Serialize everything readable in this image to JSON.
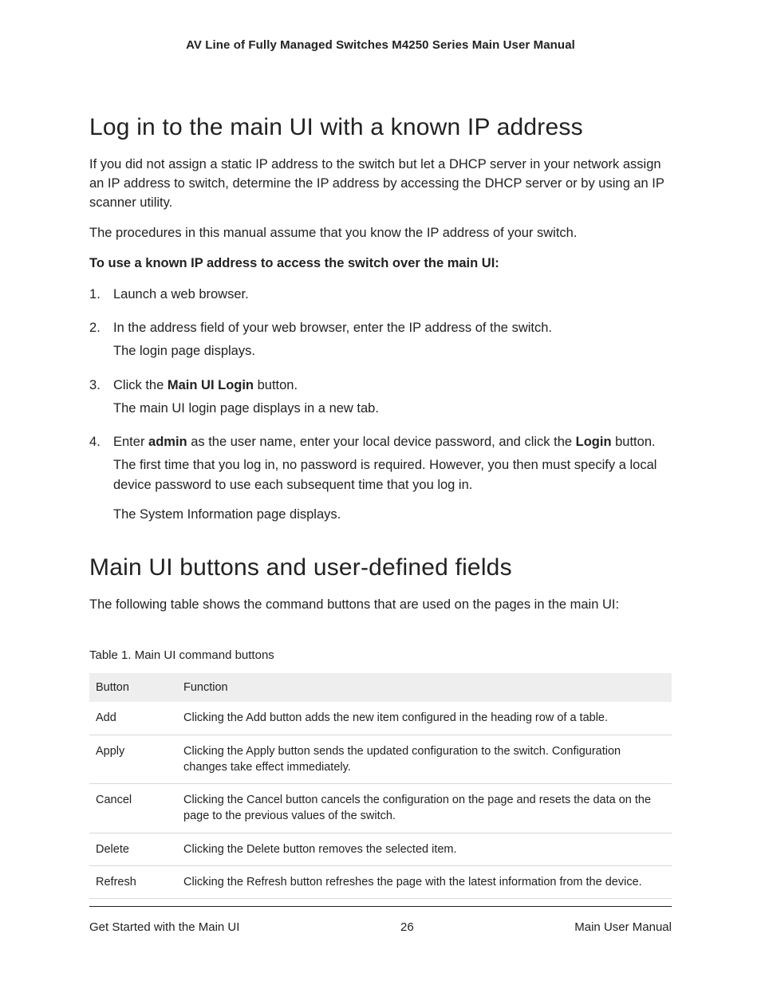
{
  "header": {
    "title": "AV Line of Fully Managed Switches M4250 Series Main User Manual"
  },
  "section1": {
    "title": "Log in to the main UI with a known IP address",
    "p1": "If you did not assign a static IP address to the switch but let a DHCP server in your network assign an IP address to switch, determine the IP address by accessing the DHCP server or by using an IP scanner utility.",
    "p2": "The procedures in this manual assume that you know the IP address of your switch.",
    "lead": "To use a known IP address to access the switch over the main UI:",
    "steps": {
      "s1": "Launch a web browser.",
      "s2a": "In the address field of your web browser, enter the IP address of the switch.",
      "s2b": "The login page displays.",
      "s3a_pre": "Click the ",
      "s3a_bold": "Main UI Login",
      "s3a_post": " button.",
      "s3b": "The main UI login page displays in a new tab.",
      "s4a_pre": "Enter ",
      "s4a_b1": "admin",
      "s4a_mid": " as the user name, enter your local device password, and click the ",
      "s4a_b2": "Login",
      "s4a_post": " button.",
      "s4b": "The first time that you log in, no password is required. However, you then must specify a local device password to use each subsequent time that you log in.",
      "s4c": "The System Information page displays."
    }
  },
  "section2": {
    "title": "Main UI buttons and user-defined fields",
    "p1": "The following table shows the command buttons that are used on the pages in the main UI:",
    "table_caption": "Table 1. Main UI command buttons",
    "columns": {
      "c1": "Button",
      "c2": "Function"
    },
    "rows": [
      {
        "button": "Add",
        "function": "Clicking the Add button adds the new item configured in the heading row of a table."
      },
      {
        "button": "Apply",
        "function": "Clicking the Apply button sends the updated configuration to the switch. Configuration changes take effect immediately."
      },
      {
        "button": "Cancel",
        "function": "Clicking the Cancel button cancels the configuration on the page and resets the data on the page to the previous values of the switch."
      },
      {
        "button": "Delete",
        "function": "Clicking the Delete button removes the selected item."
      },
      {
        "button": "Refresh",
        "function": "Clicking the Refresh button refreshes the page with the latest information from the device."
      }
    ]
  },
  "footer": {
    "left": "Get Started with the Main UI",
    "center": "26",
    "right": "Main User Manual"
  }
}
